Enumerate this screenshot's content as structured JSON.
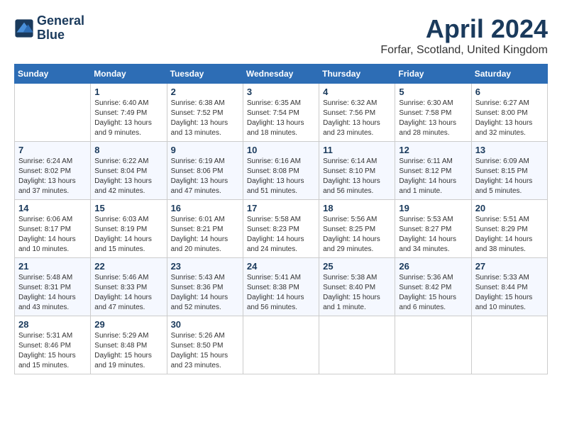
{
  "header": {
    "logo_line1": "General",
    "logo_line2": "Blue",
    "month": "April 2024",
    "location": "Forfar, Scotland, United Kingdom"
  },
  "weekdays": [
    "Sunday",
    "Monday",
    "Tuesday",
    "Wednesday",
    "Thursday",
    "Friday",
    "Saturday"
  ],
  "weeks": [
    [
      {
        "day": "",
        "info": ""
      },
      {
        "day": "1",
        "info": "Sunrise: 6:40 AM\nSunset: 7:49 PM\nDaylight: 13 hours\nand 9 minutes."
      },
      {
        "day": "2",
        "info": "Sunrise: 6:38 AM\nSunset: 7:52 PM\nDaylight: 13 hours\nand 13 minutes."
      },
      {
        "day": "3",
        "info": "Sunrise: 6:35 AM\nSunset: 7:54 PM\nDaylight: 13 hours\nand 18 minutes."
      },
      {
        "day": "4",
        "info": "Sunrise: 6:32 AM\nSunset: 7:56 PM\nDaylight: 13 hours\nand 23 minutes."
      },
      {
        "day": "5",
        "info": "Sunrise: 6:30 AM\nSunset: 7:58 PM\nDaylight: 13 hours\nand 28 minutes."
      },
      {
        "day": "6",
        "info": "Sunrise: 6:27 AM\nSunset: 8:00 PM\nDaylight: 13 hours\nand 32 minutes."
      }
    ],
    [
      {
        "day": "7",
        "info": "Sunrise: 6:24 AM\nSunset: 8:02 PM\nDaylight: 13 hours\nand 37 minutes."
      },
      {
        "day": "8",
        "info": "Sunrise: 6:22 AM\nSunset: 8:04 PM\nDaylight: 13 hours\nand 42 minutes."
      },
      {
        "day": "9",
        "info": "Sunrise: 6:19 AM\nSunset: 8:06 PM\nDaylight: 13 hours\nand 47 minutes."
      },
      {
        "day": "10",
        "info": "Sunrise: 6:16 AM\nSunset: 8:08 PM\nDaylight: 13 hours\nand 51 minutes."
      },
      {
        "day": "11",
        "info": "Sunrise: 6:14 AM\nSunset: 8:10 PM\nDaylight: 13 hours\nand 56 minutes."
      },
      {
        "day": "12",
        "info": "Sunrise: 6:11 AM\nSunset: 8:12 PM\nDaylight: 14 hours\nand 1 minute."
      },
      {
        "day": "13",
        "info": "Sunrise: 6:09 AM\nSunset: 8:15 PM\nDaylight: 14 hours\nand 5 minutes."
      }
    ],
    [
      {
        "day": "14",
        "info": "Sunrise: 6:06 AM\nSunset: 8:17 PM\nDaylight: 14 hours\nand 10 minutes."
      },
      {
        "day": "15",
        "info": "Sunrise: 6:03 AM\nSunset: 8:19 PM\nDaylight: 14 hours\nand 15 minutes."
      },
      {
        "day": "16",
        "info": "Sunrise: 6:01 AM\nSunset: 8:21 PM\nDaylight: 14 hours\nand 20 minutes."
      },
      {
        "day": "17",
        "info": "Sunrise: 5:58 AM\nSunset: 8:23 PM\nDaylight: 14 hours\nand 24 minutes."
      },
      {
        "day": "18",
        "info": "Sunrise: 5:56 AM\nSunset: 8:25 PM\nDaylight: 14 hours\nand 29 minutes."
      },
      {
        "day": "19",
        "info": "Sunrise: 5:53 AM\nSunset: 8:27 PM\nDaylight: 14 hours\nand 34 minutes."
      },
      {
        "day": "20",
        "info": "Sunrise: 5:51 AM\nSunset: 8:29 PM\nDaylight: 14 hours\nand 38 minutes."
      }
    ],
    [
      {
        "day": "21",
        "info": "Sunrise: 5:48 AM\nSunset: 8:31 PM\nDaylight: 14 hours\nand 43 minutes."
      },
      {
        "day": "22",
        "info": "Sunrise: 5:46 AM\nSunset: 8:33 PM\nDaylight: 14 hours\nand 47 minutes."
      },
      {
        "day": "23",
        "info": "Sunrise: 5:43 AM\nSunset: 8:36 PM\nDaylight: 14 hours\nand 52 minutes."
      },
      {
        "day": "24",
        "info": "Sunrise: 5:41 AM\nSunset: 8:38 PM\nDaylight: 14 hours\nand 56 minutes."
      },
      {
        "day": "25",
        "info": "Sunrise: 5:38 AM\nSunset: 8:40 PM\nDaylight: 15 hours\nand 1 minute."
      },
      {
        "day": "26",
        "info": "Sunrise: 5:36 AM\nSunset: 8:42 PM\nDaylight: 15 hours\nand 6 minutes."
      },
      {
        "day": "27",
        "info": "Sunrise: 5:33 AM\nSunset: 8:44 PM\nDaylight: 15 hours\nand 10 minutes."
      }
    ],
    [
      {
        "day": "28",
        "info": "Sunrise: 5:31 AM\nSunset: 8:46 PM\nDaylight: 15 hours\nand 15 minutes."
      },
      {
        "day": "29",
        "info": "Sunrise: 5:29 AM\nSunset: 8:48 PM\nDaylight: 15 hours\nand 19 minutes."
      },
      {
        "day": "30",
        "info": "Sunrise: 5:26 AM\nSunset: 8:50 PM\nDaylight: 15 hours\nand 23 minutes."
      },
      {
        "day": "",
        "info": ""
      },
      {
        "day": "",
        "info": ""
      },
      {
        "day": "",
        "info": ""
      },
      {
        "day": "",
        "info": ""
      }
    ]
  ]
}
